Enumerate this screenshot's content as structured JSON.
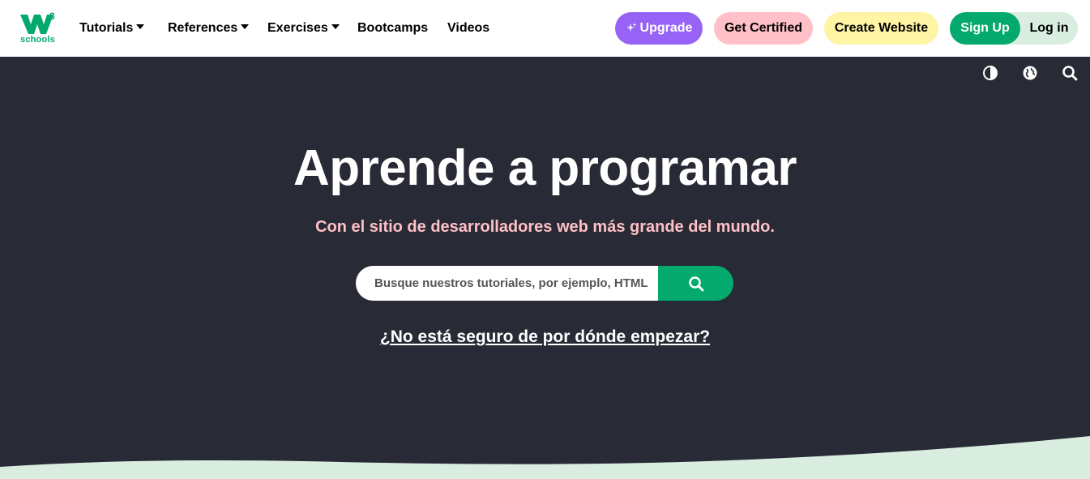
{
  "logo": {
    "text": "schools",
    "superscript": "3",
    "brand_color": "#04AA6D"
  },
  "nav": {
    "tutorials": "Tutorials",
    "references": "References",
    "exercises": "Exercises",
    "bootcamps": "Bootcamps",
    "videos": "Videos"
  },
  "actions": {
    "upgrade": "Upgrade",
    "certified": "Get Certified",
    "website": "Create Website",
    "signup": "Sign Up",
    "login": "Log in"
  },
  "utility_icons": [
    "contrast-icon",
    "globe-icon",
    "search-icon"
  ],
  "hero": {
    "title": "Aprende a programar",
    "subtitle": "Con el sitio de desarrolladores web más grande del mundo.",
    "search_placeholder": "Busque nuestros tutoriales, por ejemplo, HTML",
    "start_link": "¿No está seguro de por dónde empezar?"
  },
  "colors": {
    "hero_bg": "#282A35",
    "upgrade": "#9763F6",
    "certified": "#FFC0C7",
    "website": "#FFF4A3",
    "signup": "#04AA6D",
    "wave": "#D9EEE1"
  }
}
